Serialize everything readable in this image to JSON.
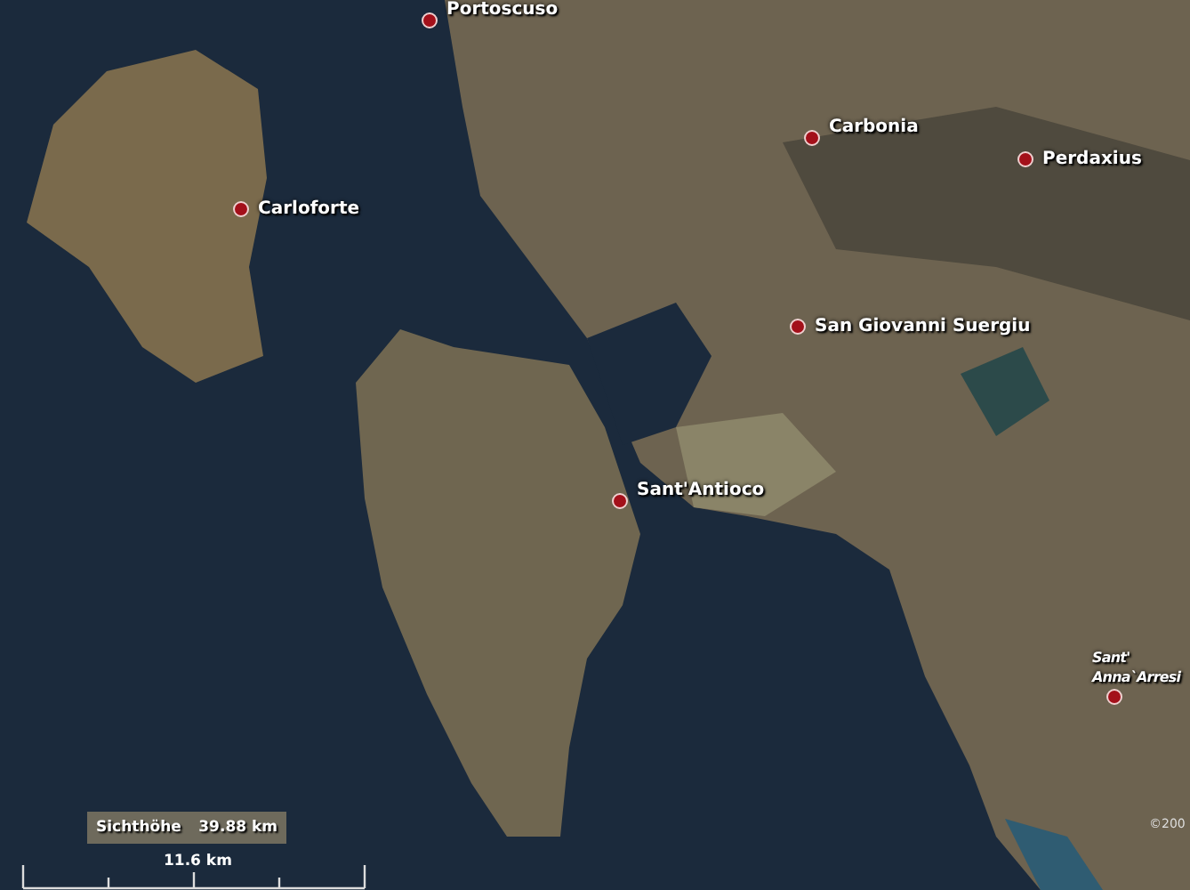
{
  "map": {
    "places": [
      {
        "name": "Portoscuso"
      },
      {
        "name": "Carbonia"
      },
      {
        "name": "Perdaxius"
      },
      {
        "name": "Carloforte"
      },
      {
        "name": "San Giovanni Suergiu"
      },
      {
        "name": "Sant'Antioco"
      },
      {
        "name": "Sant' Anna`Arresi"
      }
    ],
    "copyright": "©200"
  },
  "altitude": {
    "label": "Sichthöhe",
    "value": "39.88 km"
  },
  "scale": {
    "label": "11.6 km"
  }
}
